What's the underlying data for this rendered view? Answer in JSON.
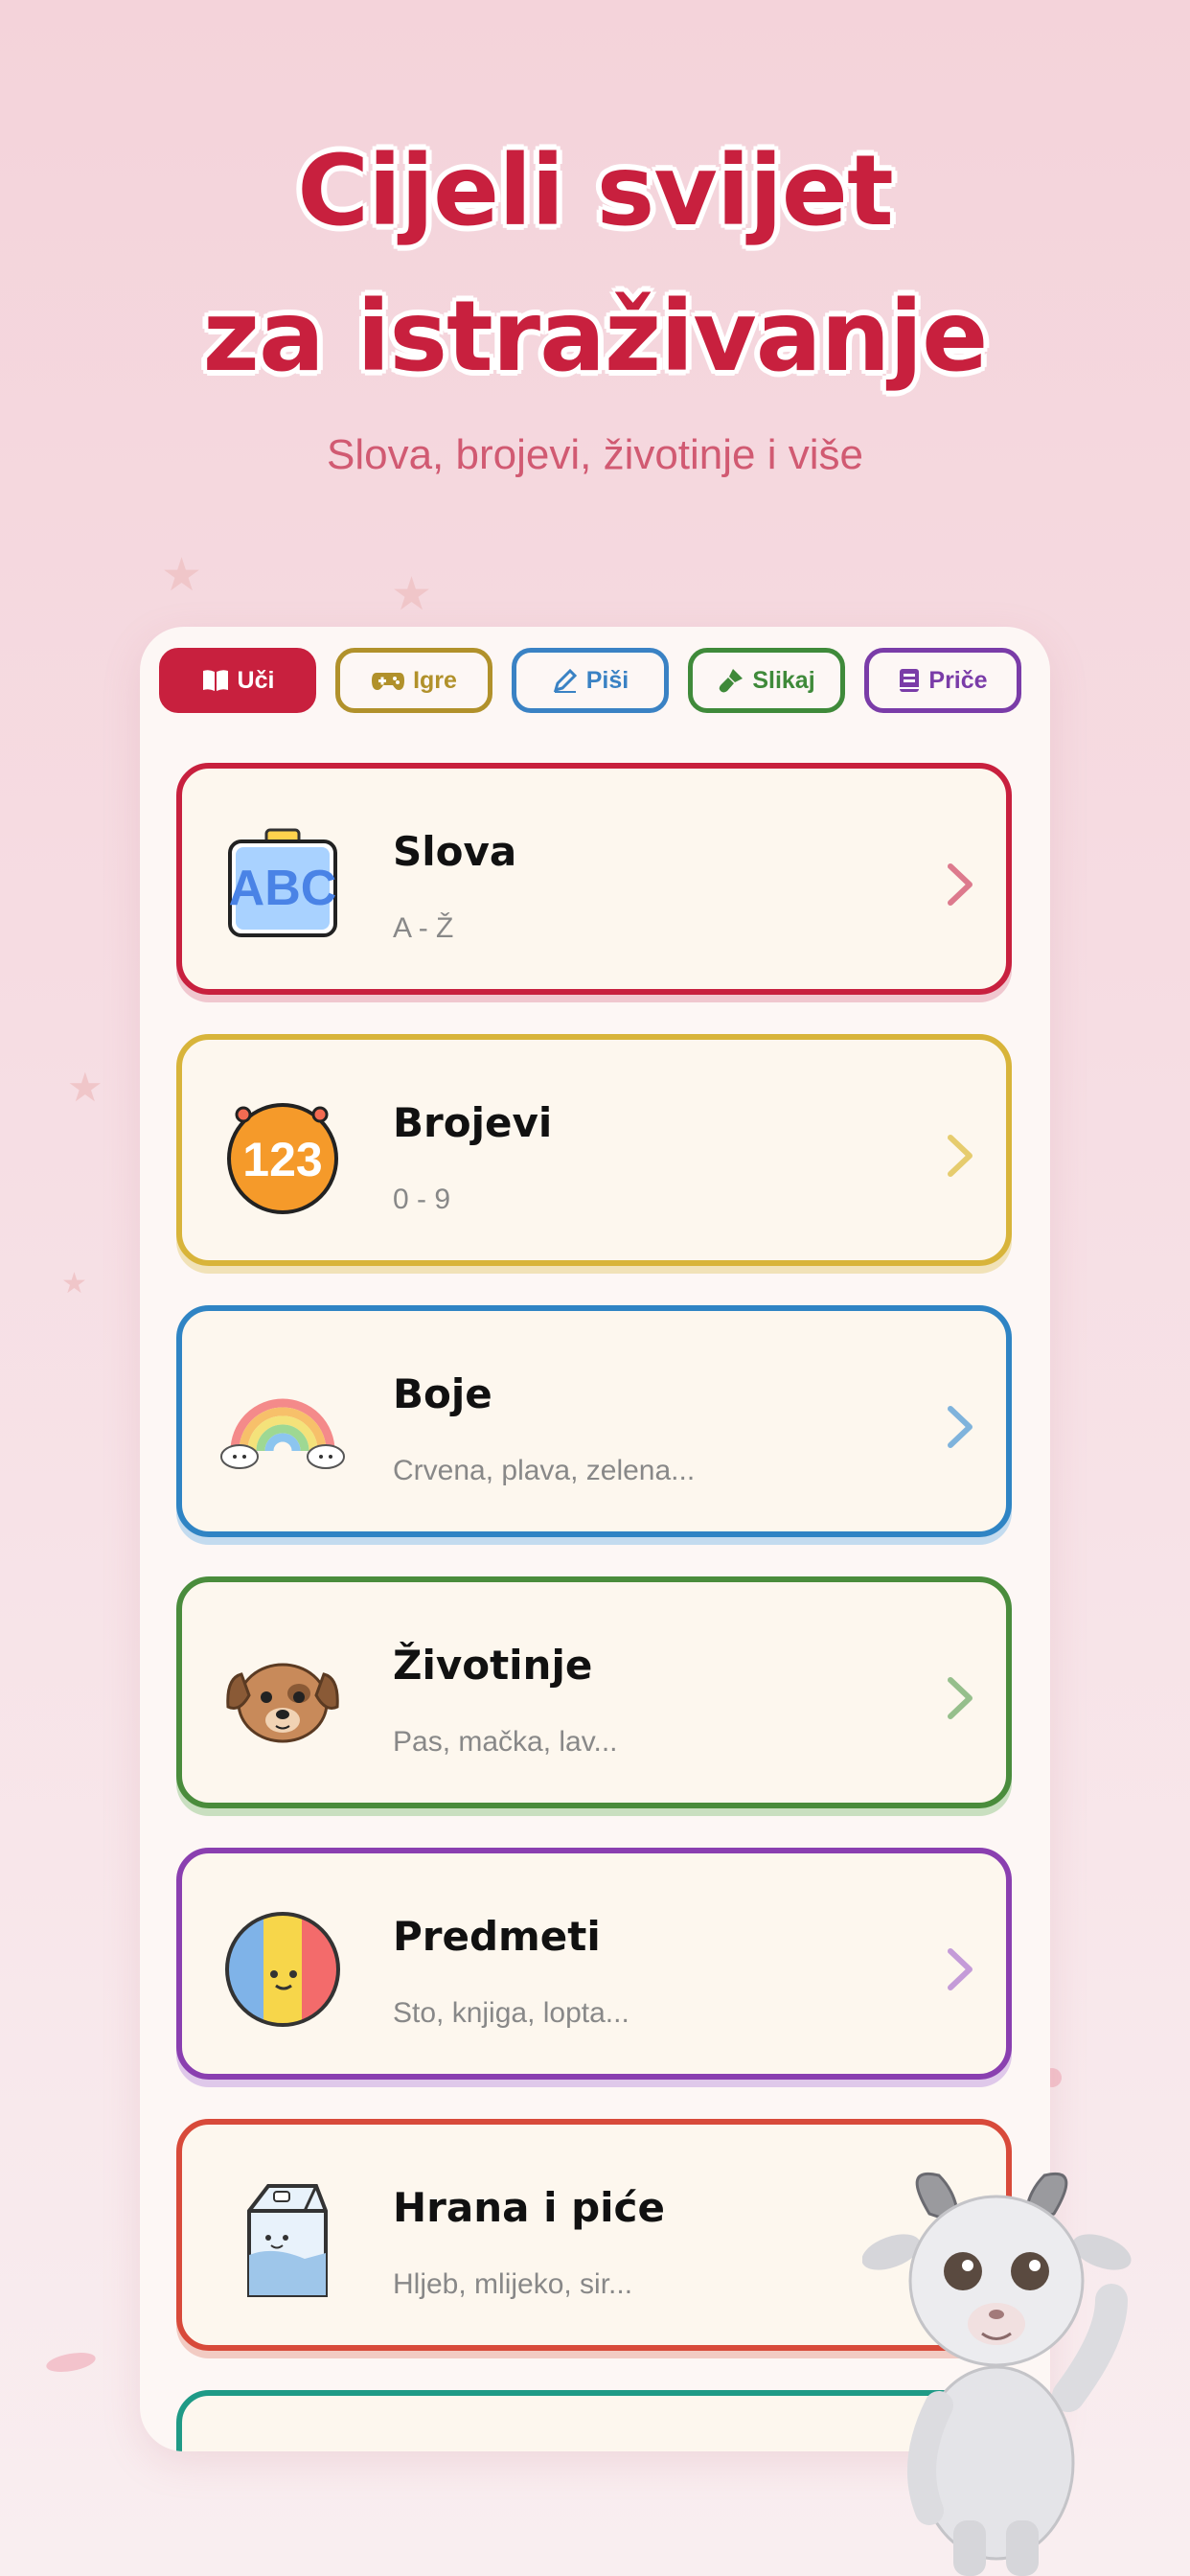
{
  "hero": {
    "title_line1": "Cijeli svijet",
    "title_line2": "za istraživanje",
    "subtitle": "Slova, brojevi, životinje i više"
  },
  "tabs": [
    {
      "label": "Uči",
      "icon": "book-icon",
      "color": "#c8203e",
      "active": true
    },
    {
      "label": "Igre",
      "icon": "gamepad-icon",
      "color": "#b1912b",
      "active": false
    },
    {
      "label": "Piši",
      "icon": "pencil-icon",
      "color": "#3a82c4",
      "active": false
    },
    {
      "label": "Slikaj",
      "icon": "brush-icon",
      "color": "#3f8a3a",
      "active": false
    },
    {
      "label": "Priče",
      "icon": "storybook-icon",
      "color": "#7a3ca8",
      "active": false
    }
  ],
  "categories": [
    {
      "title": "Slova",
      "subtitle": "A - Ž",
      "icon": "abc-board-icon",
      "color": "#c8203e"
    },
    {
      "title": "Brojevi",
      "subtitle": "0 - 9",
      "icon": "numbers-123-icon",
      "color": "#d8b43a"
    },
    {
      "title": "Boje",
      "subtitle": "Crvena, plava, zelena...",
      "icon": "rainbow-icon",
      "color": "#2f84c4"
    },
    {
      "title": "Životinje",
      "subtitle": "Pas, mačka, lav...",
      "icon": "dog-icon",
      "color": "#4a8c3c"
    },
    {
      "title": "Predmeti",
      "subtitle": "Sto, knjiga, lopta...",
      "icon": "ball-icon",
      "color": "#8a3fb0"
    },
    {
      "title": "Hrana i piće",
      "subtitle": "Hljeb, mlijeko, sir...",
      "icon": "milk-carton-icon",
      "color": "#d84a3a"
    },
    {
      "title": "",
      "subtitle": "",
      "icon": "",
      "color": "#1f9a86"
    }
  ],
  "colors": {
    "brand": "#c8203e",
    "background": "#f4d3da"
  }
}
